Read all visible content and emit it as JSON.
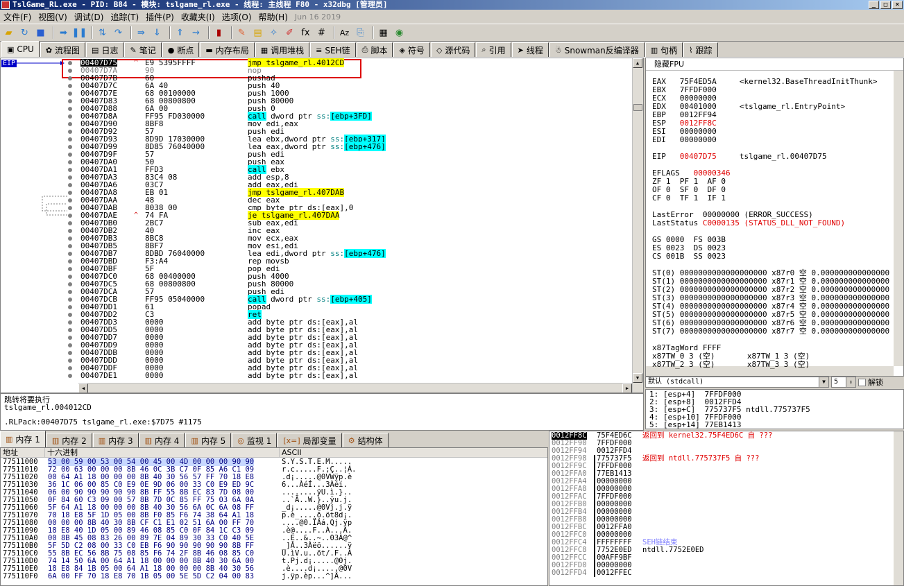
{
  "window": {
    "title": "TslGame_RL.exe - PID: B84 - 模块: tslgame_rl.exe - 线程: 主线程 F80 - x32dbg [管理员]",
    "min": "_",
    "max": "□",
    "close": "×"
  },
  "menu": [
    "文件(F)",
    "视图(V)",
    "调试(D)",
    "追踪(T)",
    "插件(P)",
    "收藏夹(I)",
    "选项(O)",
    "帮助(H)"
  ],
  "menu_date": "Jun 16 2019",
  "tabs": [
    {
      "label": "CPU",
      "icon": "cpu-icon",
      "glyph": "▣"
    },
    {
      "label": "流程图",
      "icon": "graph-icon",
      "glyph": "✿"
    },
    {
      "label": "日志",
      "icon": "log-icon",
      "glyph": "▤"
    },
    {
      "label": "笔记",
      "icon": "notes-icon",
      "glyph": "✎"
    },
    {
      "label": "断点",
      "icon": "breakpoint-icon",
      "glyph": "●"
    },
    {
      "label": "内存布局",
      "icon": "memory-map-icon",
      "glyph": "▬"
    },
    {
      "label": "调用堆栈",
      "icon": "call-stack-icon",
      "glyph": "▦"
    },
    {
      "label": "SEH链",
      "icon": "seh-icon",
      "glyph": "≡"
    },
    {
      "label": "脚本",
      "icon": "script-icon",
      "glyph": "⎙"
    },
    {
      "label": "符号",
      "icon": "symbols-icon",
      "glyph": "◈"
    },
    {
      "label": "源代码",
      "icon": "source-icon",
      "glyph": "◇"
    },
    {
      "label": "引用",
      "icon": "references-icon",
      "glyph": "⌕"
    },
    {
      "label": "线程",
      "icon": "threads-icon",
      "glyph": "➤"
    },
    {
      "label": "Snowman反编译器",
      "icon": "snowman-icon",
      "glyph": "☃"
    },
    {
      "label": "句柄",
      "icon": "handles-icon",
      "glyph": "▥"
    },
    {
      "label": "跟踪",
      "icon": "trace-icon",
      "glyph": "⌇"
    }
  ],
  "eip_label": "EIP",
  "disasm": [
    [
      "00407D75",
      "^",
      "E9 5395FFFF",
      "jmp tslgame_rl.4012CD",
      "jmp"
    ],
    [
      "00407D7A",
      "",
      "90",
      "nop",
      "gray"
    ],
    [
      "00407D7B",
      "",
      "60",
      "pushad",
      ""
    ],
    [
      "00407D7C",
      "",
      "6A 40",
      "push 40",
      ""
    ],
    [
      "00407D7E",
      "",
      "68 00100000",
      "push 1000",
      ""
    ],
    [
      "00407D83",
      "",
      "68 00800800",
      "push 80000",
      ""
    ],
    [
      "00407D88",
      "",
      "6A 00",
      "push 0",
      ""
    ],
    [
      "00407D8A",
      "",
      "FF95 FD030000",
      "call dword ptr ss:[ebp+3FD]",
      "call"
    ],
    [
      "00407D90",
      "",
      "8BF8",
      "mov edi,eax",
      ""
    ],
    [
      "00407D92",
      "",
      "57",
      "push edi",
      ""
    ],
    [
      "00407D93",
      "",
      "8D9D 17030000",
      "lea ebx,dword ptr ss:[ebp+317]",
      "mem"
    ],
    [
      "00407D99",
      "",
      "8D85 76040000",
      "lea eax,dword ptr ss:[ebp+476]",
      "mem"
    ],
    [
      "00407D9F",
      "",
      "57",
      "push edi",
      ""
    ],
    [
      "00407DA0",
      "",
      "50",
      "push eax",
      ""
    ],
    [
      "00407DA1",
      "",
      "FFD3",
      "call ebx",
      "call"
    ],
    [
      "00407DA3",
      "",
      "83C4 08",
      "add esp,8",
      ""
    ],
    [
      "00407DA6",
      "",
      "03C7",
      "add eax,edi",
      ""
    ],
    [
      "00407DA8",
      "",
      "EB 01",
      "jmp tslgame_rl.407DAB",
      "jmp"
    ],
    [
      "00407DAA",
      "",
      "48",
      "dec eax",
      ""
    ],
    [
      "00407DAB",
      "",
      "8038 00",
      "cmp byte ptr ds:[eax],0",
      ""
    ],
    [
      "00407DAE",
      "^",
      "74 FA",
      "je tslgame_rl.407DAA",
      "jmp"
    ],
    [
      "00407DB0",
      "",
      "2BC7",
      "sub eax,edi",
      ""
    ],
    [
      "00407DB2",
      "",
      "40",
      "inc eax",
      ""
    ],
    [
      "00407DB3",
      "",
      "8BC8",
      "mov ecx,eax",
      ""
    ],
    [
      "00407DB5",
      "",
      "8BF7",
      "mov esi,edi",
      ""
    ],
    [
      "00407DB7",
      "",
      "8DBD 76040000",
      "lea edi,dword ptr ss:[ebp+476]",
      "mem"
    ],
    [
      "00407DBD",
      "",
      "F3:A4",
      "rep movsb",
      ""
    ],
    [
      "00407DBF",
      "",
      "5F",
      "pop edi",
      ""
    ],
    [
      "00407DC0",
      "",
      "68 00400000",
      "push 4000",
      ""
    ],
    [
      "00407DC5",
      "",
      "68 00800800",
      "push 80000",
      ""
    ],
    [
      "00407DCA",
      "",
      "57",
      "push edi",
      ""
    ],
    [
      "00407DCB",
      "",
      "FF95 05040000",
      "call dword ptr ss:[ebp+405]",
      "call"
    ],
    [
      "00407DD1",
      "",
      "61",
      "popad",
      ""
    ],
    [
      "00407DD2",
      "",
      "C3",
      "ret",
      "call"
    ],
    [
      "00407DD3",
      "",
      "0000",
      "add byte ptr ds:[eax],al",
      ""
    ],
    [
      "00407DD5",
      "",
      "0000",
      "add byte ptr ds:[eax],al",
      ""
    ],
    [
      "00407DD7",
      "",
      "0000",
      "add byte ptr ds:[eax],al",
      ""
    ],
    [
      "00407DD9",
      "",
      "0000",
      "add byte ptr ds:[eax],al",
      ""
    ],
    [
      "00407DDB",
      "",
      "0000",
      "add byte ptr ds:[eax],al",
      ""
    ],
    [
      "00407DDD",
      "",
      "0000",
      "add byte ptr ds:[eax],al",
      ""
    ],
    [
      "00407DDF",
      "",
      "0000",
      "add byte ptr ds:[eax],al",
      ""
    ],
    [
      "00407DE1",
      "",
      "0000",
      "add byte ptr ds:[eax],al",
      ""
    ]
  ],
  "registers": {
    "header": "隐藏FPU",
    "lines": [
      [
        "EAX   75F4ED5A     <kernel32.BaseThreadInitThunk>",
        ""
      ],
      [
        "EBX   7FFDF000",
        ""
      ],
      [
        "ECX   00000000",
        ""
      ],
      [
        "EDX   00401000     <tslgame_rl.EntryPoint>",
        ""
      ],
      [
        "EBP   0012FF94",
        ""
      ],
      [
        "ESP   0012FF8C",
        "red"
      ],
      [
        "ESI   00000000",
        ""
      ],
      [
        "EDI   00000000",
        ""
      ],
      [
        "",
        ""
      ],
      [
        "EIP   00407D75     tslgame_rl.00407D75",
        "eip"
      ],
      [
        "",
        ""
      ],
      [
        "EFLAGS   00000346",
        "red"
      ],
      [
        "ZF 1  PF 1  AF 0",
        ""
      ],
      [
        "OF 0  SF 0  DF 0",
        ""
      ],
      [
        "CF 0  TF 1  IF 1",
        ""
      ],
      [
        "",
        ""
      ],
      [
        "LastError  00000000 (ERROR_SUCCESS)",
        ""
      ],
      [
        "LastStatus C0000135 (STATUS_DLL_NOT_FOUND)",
        "red"
      ],
      [
        "",
        ""
      ],
      [
        "GS 0000  FS 003B",
        ""
      ],
      [
        "ES 0023  DS 0023",
        ""
      ],
      [
        "CS 001B  SS 0023",
        ""
      ],
      [
        "",
        ""
      ],
      [
        "ST(0) 0000000000000000000 x87r0 空 0.000000000000000",
        ""
      ],
      [
        "ST(1) 0000000000000000000 x87r1 空 0.000000000000000",
        ""
      ],
      [
        "ST(2) 0000000000000000000 x87r2 空 0.000000000000000",
        ""
      ],
      [
        "ST(3) 0000000000000000000 x87r3 空 0.000000000000000",
        ""
      ],
      [
        "ST(4) 0000000000000000000 x87r4 空 0.000000000000000",
        ""
      ],
      [
        "ST(5) 0000000000000000000 x87r5 空 0.000000000000000",
        ""
      ],
      [
        "ST(6) 0000000000000000000 x87r6 空 0.000000000000000",
        ""
      ],
      [
        "ST(7) 0000000000000000000 x87r7 空 0.000000000000000",
        ""
      ],
      [
        "",
        ""
      ],
      [
        "x87TagWord FFFF",
        ""
      ],
      [
        "x87TW_0 3 (空)       x87TW_1 3 (空)",
        ""
      ],
      [
        "x87TW_2 3 (空)       x87TW_3 3 (空)",
        ""
      ]
    ]
  },
  "callconv": {
    "value": "默认 (stdcall)",
    "count": "5",
    "unlock": "解锁"
  },
  "stack_args": [
    "1: [esp+4]  7FFDF000",
    "2: [esp+8]  0012FFD4",
    "3: [esp+C]  775737F5 ntdll.775737F5",
    "4: [esp+10] 7FFDF000",
    "5: [esp+14] 77EB1413"
  ],
  "info": {
    "line1": "跳转将要执行",
    "line2": "tslgame_rl.004012CD",
    "line3": ".RLPack:00407D75 tslgame_rl.exe:$7D75 #1175"
  },
  "bottom_tabs": [
    {
      "label": "内存 1",
      "icon": "memory-icon"
    },
    {
      "label": "内存 2",
      "icon": "memory-icon"
    },
    {
      "label": "内存 3",
      "icon": "memory-icon"
    },
    {
      "label": "内存 4",
      "icon": "memory-icon"
    },
    {
      "label": "内存 5",
      "icon": "memory-icon"
    },
    {
      "label": "监视 1",
      "icon": "watch-icon"
    },
    {
      "label": "局部变量",
      "icon": "locals-icon"
    },
    {
      "label": "结构体",
      "icon": "struct-icon"
    }
  ],
  "dump": {
    "headers": {
      "addr": "地址",
      "hex": "十六进制",
      "ascii": "ASCII"
    },
    "rows": [
      [
        "77511000",
        "53 00 59 00 53 00 54 00 45 00 4D 00 00 00 90 90",
        "S.Y.S.T.E.M....."
      ],
      [
        "77511010",
        "72 00 63 00 00 00 8B 46 0C 3B C7 0F 85 A6 C1 09",
        "r.c.....F.;Ç..¦Á."
      ],
      [
        "77511020",
        "00 64 A1 18 00 00 00 8B 40 30 56 57 FF 70 18 E8",
        ".d¡.....@0VWÿp.è"
      ],
      [
        "77511030",
        "36 1C 06 00 85 C0 E9 0E 9D 06 00 33 C0 E9 ED 9C",
        "6...ÀéÍ...3Àéí."
      ],
      [
        "77511040",
        "06 00 90 90 90 90 90 8B FF 55 8B EC 83 7D 08 00",
        "........ÿU.ì.}.."
      ],
      [
        "77511050",
        "0F 84 60 C3 09 00 57 8B 7D 0C 85 FF 75 03 6A 0A",
        "..`Ã..W.}..ÿu.j."
      ],
      [
        "77511060",
        "5F 64 A1 18 00 00 00 8B 40 30 56 6A 0C 6A 08 FF",
        "_d¡.....@0Vj.j.ÿ"
      ],
      [
        "77511070",
        "70 18 E8 5F 1D 05 00 8B F0 85 F6 74 38 64 A1 18",
        "p.è_....ð.öt8d¡."
      ],
      [
        "77511080",
        "00 00 00 8B 40 30 8B CF C1 E1 02 51 6A 00 FF 70",
        "....@0.ÏÁá.Qj.ÿp"
      ],
      [
        "77511090",
        "18 E8 40 1D 05 00 89 46 08 85 C0 0F 84 1C C3 09",
        ".è@....F..À...Ã."
      ],
      [
        "775110A0",
        "00 8B 45 08 83 26 00 89 7E 04 89 30 33 C0 40 5E",
        "..E..&..~..03À@^"
      ],
      [
        "775110B0",
        "5F 5D C2 08 00 33 C0 EB F6 90 90 90 90 90 8B FF",
        "_]Â..3Àëö......ÿ"
      ],
      [
        "775110C0",
        "55 8B EC 56 8B 75 08 85 F6 74 2F 8B 46 08 85 C0",
        "U.ìV.u..öt/.F..À"
      ],
      [
        "775110D0",
        "74 14 50 6A 00 64 A1 18 00 00 00 8B 40 30 6A 00",
        "t.Pj.d¡.....@0j."
      ],
      [
        "775110E0",
        "18 E8 84 1B 05 00 64 A1 18 00 00 00 8B 40 30 56",
        ".è....d¡.....@0V"
      ],
      [
        "775110F0",
        "6A 00 FF 70 18 E8 70 1B 05 00 5E 5D C2 04 00 83",
        "j.ÿp.èp...^]Â..."
      ]
    ]
  },
  "stack": {
    "rows": [
      [
        "0012FF8C",
        "75F4ED6C",
        "返回到 kernel32.75F4ED6C 自 ???",
        "sel"
      ],
      [
        "0012FF90",
        "7FFDF000",
        "",
        ""
      ],
      [
        "0012FF94",
        "0012FFD4",
        "",
        ""
      ],
      [
        "0012FF98",
        "775737F5",
        "返回到 ntdll.775737F5 自 ???",
        "ret"
      ],
      [
        "0012FF9C",
        "7FFDF000",
        "",
        ""
      ],
      [
        "0012FFA0",
        "77EB1413",
        "",
        ""
      ],
      [
        "0012FFA4",
        "00000000",
        "",
        ""
      ],
      [
        "0012FFA8",
        "00000000",
        "",
        ""
      ],
      [
        "0012FFAC",
        "7FFDF000",
        "",
        ""
      ],
      [
        "0012FFB0",
        "00000000",
        "",
        ""
      ],
      [
        "0012FFB4",
        "00000000",
        "",
        ""
      ],
      [
        "0012FFB8",
        "00000000",
        "",
        ""
      ],
      [
        "0012FFBC",
        "0012FFA0",
        "",
        ""
      ],
      [
        "0012FFC0",
        "00000000",
        "",
        ""
      ],
      [
        "0012FFC4",
        "FFFFFFFF",
        "SEH链结束",
        "seh"
      ],
      [
        "0012FFC8",
        "7752E0ED",
        "ntdll.7752E0ED",
        ""
      ],
      [
        "0012FFCC",
        "00AFF9BF",
        "",
        ""
      ],
      [
        "0012FFD0",
        "00000000",
        "",
        ""
      ],
      [
        "0012FFD4",
        "0012FFEC",
        "",
        ""
      ]
    ]
  },
  "colors": {
    "jmp_highlight": "#ffff00",
    "call_highlight": "#00ffff",
    "red_text": "#e00000",
    "highlight_box": "#d00000"
  }
}
